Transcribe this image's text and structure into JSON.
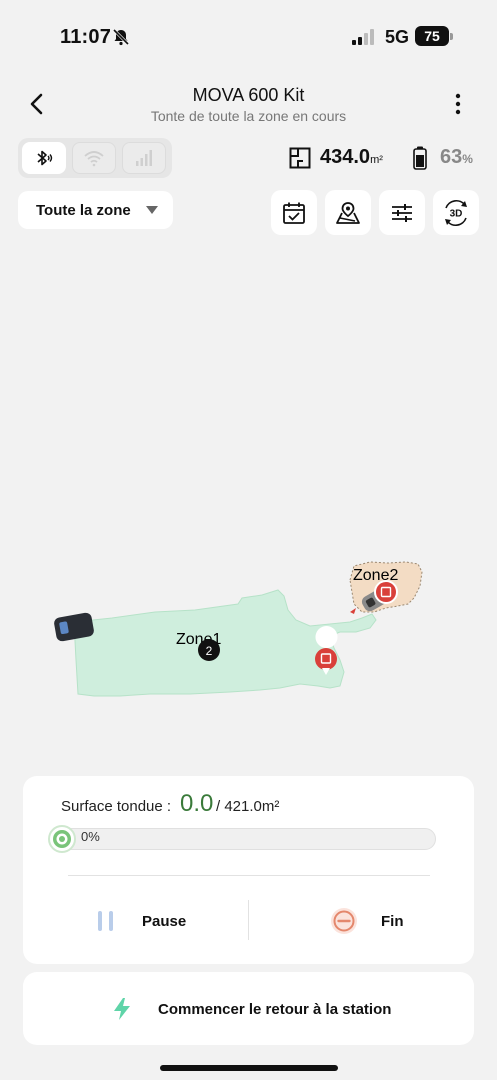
{
  "status_bar": {
    "time": "11:07",
    "network": "5G",
    "battery": "75"
  },
  "header": {
    "title": "MOVA 600 Kit",
    "subtitle": "Tonte de toute la zone en cours"
  },
  "connection": {
    "bluetooth_icon": "bluetooth-icon",
    "wifi_icon": "wifi-icon",
    "cellular_icon": "cellular-icon",
    "active": "bluetooth"
  },
  "stats": {
    "area_value": "434.0",
    "area_unit": "m²",
    "battery_value": "63",
    "battery_unit": "%"
  },
  "zone_selector": {
    "label": "Toute la zone"
  },
  "toolbar": {
    "schedule_icon": "calendar-check-icon",
    "map_icon": "map-pin-icon",
    "settings_icon": "sliders-icon",
    "view_3d_label": "3D"
  },
  "map": {
    "zone1_label": "Zone1",
    "zone1_badge": "2",
    "zone2_label": "Zone2",
    "zone_color": "#cfeedd",
    "zone2_color": "#f3dcc4"
  },
  "mowing": {
    "label": "Surface tondue :",
    "value": "0.0",
    "total": "/ 421.0m²",
    "progress_percent": "0%",
    "progress_fraction": 0,
    "accent_color": "#3a7a3a"
  },
  "actions": {
    "pause_label": "Pause",
    "end_label": "Fin",
    "return_label": "Commencer le retour à la station"
  }
}
